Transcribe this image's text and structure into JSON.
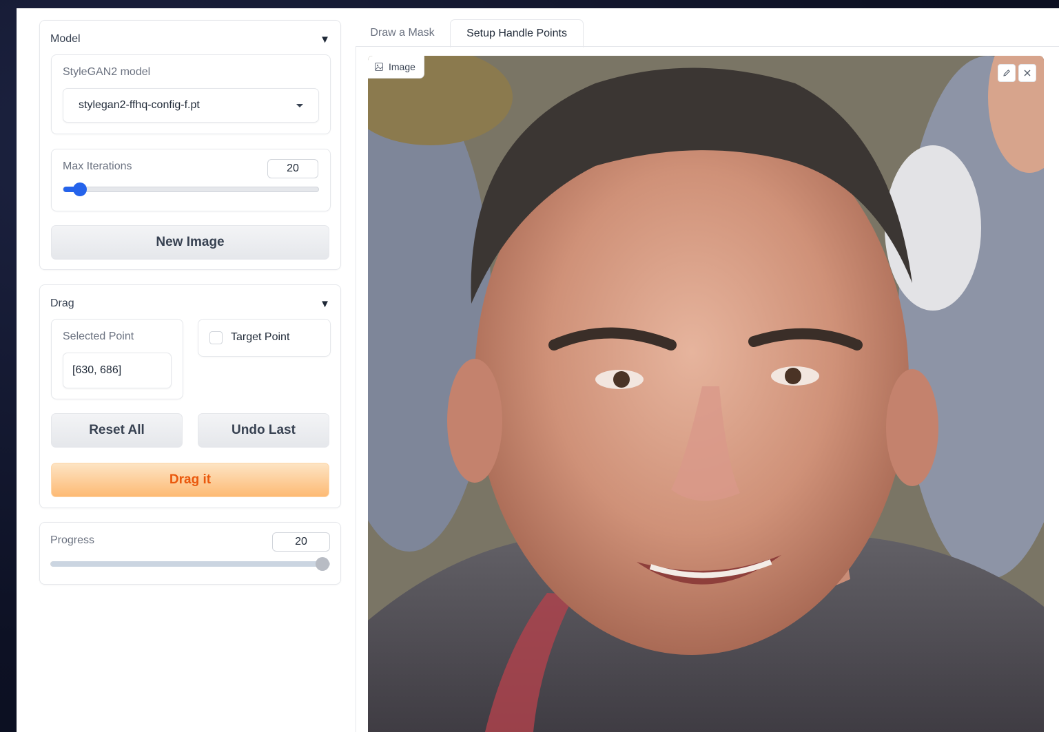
{
  "model_panel": {
    "title": "Model",
    "stylegan_label": "StyleGAN2 model",
    "stylegan_value": "stylegan2-ffhq-config-f.pt",
    "max_iter_label": "Max Iterations",
    "max_iter_value": "20",
    "new_image_label": "New Image"
  },
  "drag_panel": {
    "title": "Drag",
    "selected_point_label": "Selected Point",
    "selected_point_value": "[630, 686]",
    "target_point_label": "Target Point",
    "reset_label": "Reset All",
    "undo_label": "Undo Last",
    "drag_label": "Drag it"
  },
  "progress_panel": {
    "label": "Progress",
    "value": "20",
    "level": 1.0
  },
  "tabs": [
    {
      "label": "Draw a Mask",
      "active": false
    },
    {
      "label": "Setup Handle Points",
      "active": true
    }
  ],
  "image_panel": {
    "badge_label": "Image"
  },
  "icons": {
    "collapse": "caret-down-icon",
    "dropdown": "chevron-down-icon",
    "image": "image-icon",
    "edit": "pencil-icon",
    "close": "close-icon"
  },
  "colors": {
    "accent_blue": "#2563eb",
    "primary_orange": "#ea580c",
    "slider_gray": "#9ca3af"
  }
}
